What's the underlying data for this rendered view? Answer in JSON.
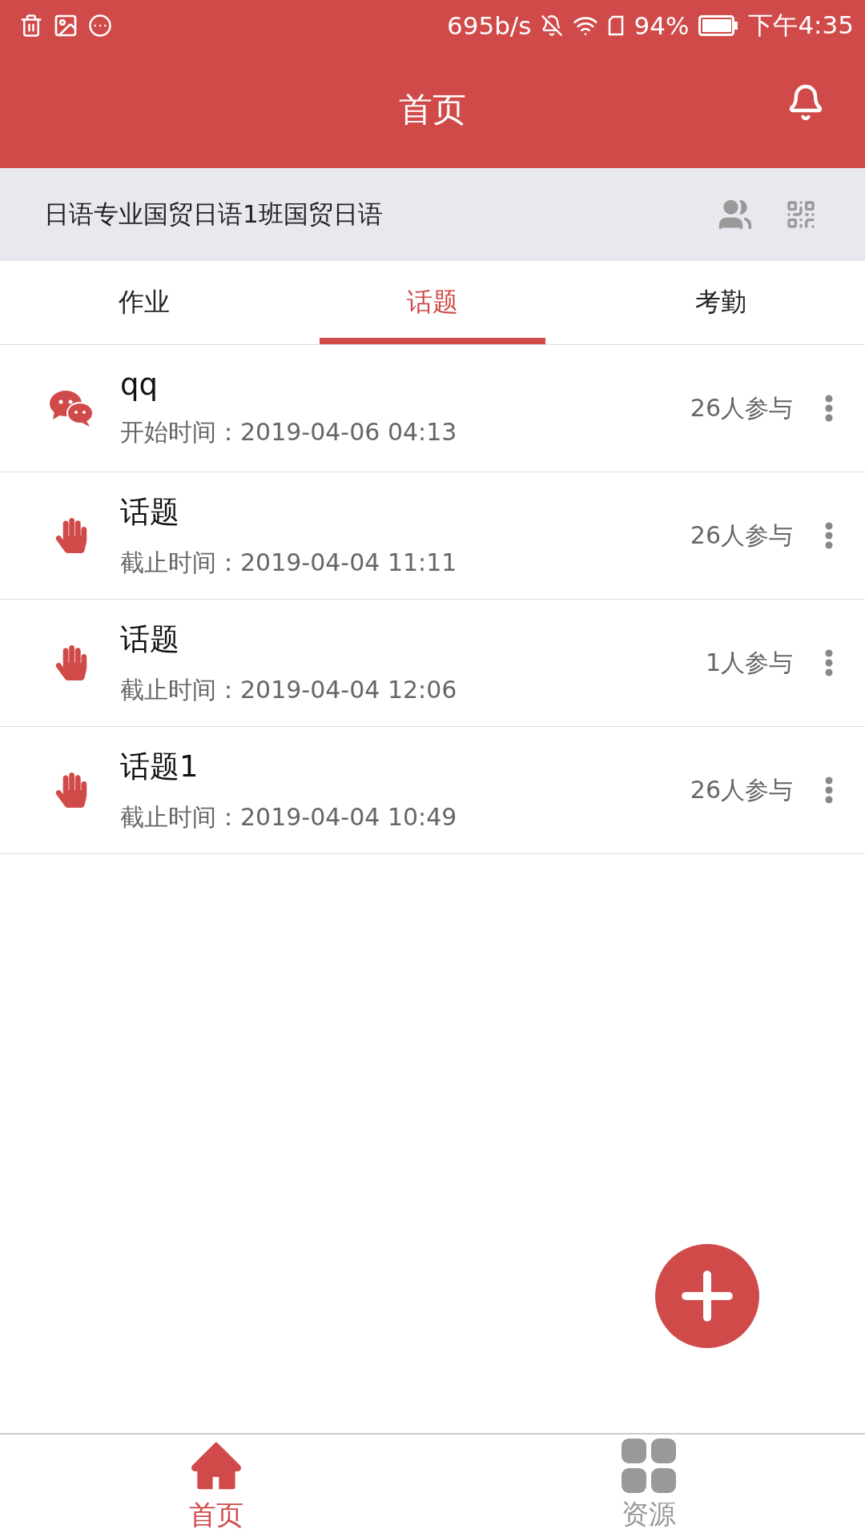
{
  "status_bar": {
    "speed": "695b/s",
    "battery": "94%",
    "time": "下午4:35"
  },
  "header": {
    "title": "首页"
  },
  "class_bar": {
    "name": "日语专业国贸日语1班国贸日语"
  },
  "tabs": [
    {
      "label": "作业",
      "selected": false
    },
    {
      "label": "话题",
      "selected": true
    },
    {
      "label": "考勤",
      "selected": false
    }
  ],
  "topics": [
    {
      "kind": "chat",
      "title": "qq",
      "time": "开始时间：2019-04-06 04:13",
      "participants": "26人参与"
    },
    {
      "kind": "hand",
      "title": "话题",
      "time": "截止时间：2019-04-04 11:11",
      "participants": "26人参与"
    },
    {
      "kind": "hand",
      "title": "话题",
      "time": "截止时间：2019-04-04 12:06",
      "participants": "1人参与"
    },
    {
      "kind": "hand",
      "title": "话题1",
      "time": "截止时间：2019-04-04 10:49",
      "participants": "26人参与"
    }
  ],
  "bottom_nav": [
    {
      "kind": "home",
      "label": "首页",
      "selected": true
    },
    {
      "kind": "resources",
      "label": "资源",
      "selected": false
    }
  ]
}
